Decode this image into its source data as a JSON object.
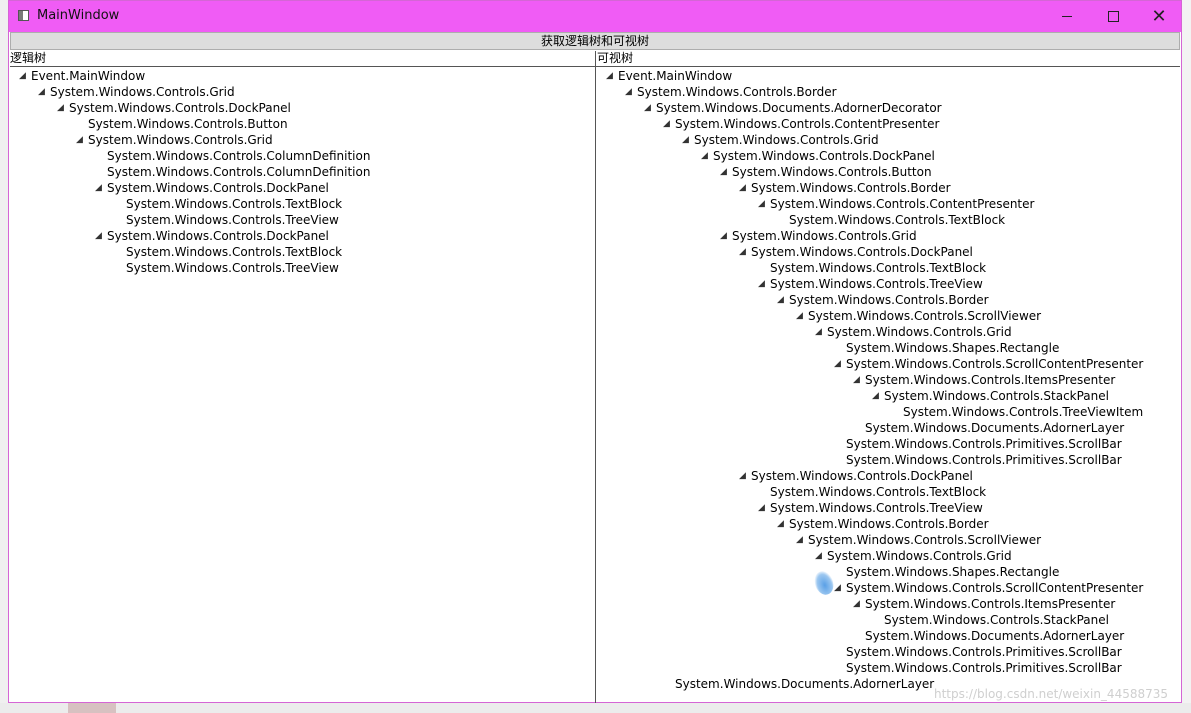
{
  "window": {
    "title": "MainWindow",
    "action_button": "获取逻辑树和可视树"
  },
  "logical": {
    "header": "逻辑树",
    "nodes": [
      {
        "depth": 0,
        "expanded": true,
        "text": "Event.MainWindow"
      },
      {
        "depth": 1,
        "expanded": true,
        "text": "System.Windows.Controls.Grid"
      },
      {
        "depth": 2,
        "expanded": true,
        "text": "System.Windows.Controls.DockPanel"
      },
      {
        "depth": 3,
        "expanded": false,
        "text": "System.Windows.Controls.Button"
      },
      {
        "depth": 3,
        "expanded": true,
        "text": "System.Windows.Controls.Grid"
      },
      {
        "depth": 4,
        "expanded": false,
        "text": "System.Windows.Controls.ColumnDefinition"
      },
      {
        "depth": 4,
        "expanded": false,
        "text": "System.Windows.Controls.ColumnDefinition"
      },
      {
        "depth": 4,
        "expanded": true,
        "text": "System.Windows.Controls.DockPanel"
      },
      {
        "depth": 5,
        "expanded": false,
        "text": "System.Windows.Controls.TextBlock"
      },
      {
        "depth": 5,
        "expanded": false,
        "text": "System.Windows.Controls.TreeView"
      },
      {
        "depth": 4,
        "expanded": true,
        "text": "System.Windows.Controls.DockPanel"
      },
      {
        "depth": 5,
        "expanded": false,
        "text": "System.Windows.Controls.TextBlock"
      },
      {
        "depth": 5,
        "expanded": false,
        "text": "System.Windows.Controls.TreeView"
      }
    ]
  },
  "visual": {
    "header": "可视树",
    "nodes": [
      {
        "depth": 0,
        "expanded": true,
        "text": "Event.MainWindow"
      },
      {
        "depth": 1,
        "expanded": true,
        "text": "System.Windows.Controls.Border"
      },
      {
        "depth": 2,
        "expanded": true,
        "text": "System.Windows.Documents.AdornerDecorator"
      },
      {
        "depth": 3,
        "expanded": true,
        "text": "System.Windows.Controls.ContentPresenter"
      },
      {
        "depth": 4,
        "expanded": true,
        "text": "System.Windows.Controls.Grid"
      },
      {
        "depth": 5,
        "expanded": true,
        "text": "System.Windows.Controls.DockPanel"
      },
      {
        "depth": 6,
        "expanded": true,
        "text": "System.Windows.Controls.Button"
      },
      {
        "depth": 7,
        "expanded": true,
        "text": "System.Windows.Controls.Border"
      },
      {
        "depth": 8,
        "expanded": true,
        "text": "System.Windows.Controls.ContentPresenter"
      },
      {
        "depth": 9,
        "expanded": false,
        "text": "System.Windows.Controls.TextBlock"
      },
      {
        "depth": 6,
        "expanded": true,
        "text": "System.Windows.Controls.Grid"
      },
      {
        "depth": 7,
        "expanded": true,
        "text": "System.Windows.Controls.DockPanel"
      },
      {
        "depth": 8,
        "expanded": false,
        "text": "System.Windows.Controls.TextBlock"
      },
      {
        "depth": 8,
        "expanded": true,
        "text": "System.Windows.Controls.TreeView"
      },
      {
        "depth": 9,
        "expanded": true,
        "text": "System.Windows.Controls.Border"
      },
      {
        "depth": 10,
        "expanded": true,
        "text": "System.Windows.Controls.ScrollViewer"
      },
      {
        "depth": 11,
        "expanded": true,
        "text": "System.Windows.Controls.Grid"
      },
      {
        "depth": 12,
        "expanded": false,
        "text": "System.Windows.Shapes.Rectangle"
      },
      {
        "depth": 12,
        "expanded": true,
        "text": "System.Windows.Controls.ScrollContentPresenter"
      },
      {
        "depth": 13,
        "expanded": true,
        "text": "System.Windows.Controls.ItemsPresenter"
      },
      {
        "depth": 14,
        "expanded": true,
        "text": "System.Windows.Controls.StackPanel"
      },
      {
        "depth": 15,
        "expanded": false,
        "text": "System.Windows.Controls.TreeViewItem"
      },
      {
        "depth": 13,
        "expanded": false,
        "text": "System.Windows.Documents.AdornerLayer"
      },
      {
        "depth": 12,
        "expanded": false,
        "text": "System.Windows.Controls.Primitives.ScrollBar"
      },
      {
        "depth": 12,
        "expanded": false,
        "text": "System.Windows.Controls.Primitives.ScrollBar"
      },
      {
        "depth": 7,
        "expanded": true,
        "text": "System.Windows.Controls.DockPanel"
      },
      {
        "depth": 8,
        "expanded": false,
        "text": "System.Windows.Controls.TextBlock"
      },
      {
        "depth": 8,
        "expanded": true,
        "text": "System.Windows.Controls.TreeView"
      },
      {
        "depth": 9,
        "expanded": true,
        "text": "System.Windows.Controls.Border"
      },
      {
        "depth": 10,
        "expanded": true,
        "text": "System.Windows.Controls.ScrollViewer"
      },
      {
        "depth": 11,
        "expanded": true,
        "text": "System.Windows.Controls.Grid"
      },
      {
        "depth": 12,
        "expanded": false,
        "text": "System.Windows.Shapes.Rectangle"
      },
      {
        "depth": 12,
        "expanded": true,
        "text": "System.Windows.Controls.ScrollContentPresenter"
      },
      {
        "depth": 13,
        "expanded": true,
        "text": "System.Windows.Controls.ItemsPresenter"
      },
      {
        "depth": 14,
        "expanded": false,
        "text": "System.Windows.Controls.StackPanel"
      },
      {
        "depth": 13,
        "expanded": false,
        "text": "System.Windows.Documents.AdornerLayer"
      },
      {
        "depth": 12,
        "expanded": false,
        "text": "System.Windows.Controls.Primitives.ScrollBar"
      },
      {
        "depth": 12,
        "expanded": false,
        "text": "System.Windows.Controls.Primitives.ScrollBar"
      },
      {
        "depth": 3,
        "expanded": false,
        "text": "System.Windows.Documents.AdornerLayer"
      }
    ]
  },
  "watermark": "https://blog.csdn.net/weixin_44588735",
  "colors": {
    "titlebar": "#f05cf5",
    "button_bg": "#dddddd"
  },
  "icons": {
    "expanded_arrow": "◢"
  }
}
